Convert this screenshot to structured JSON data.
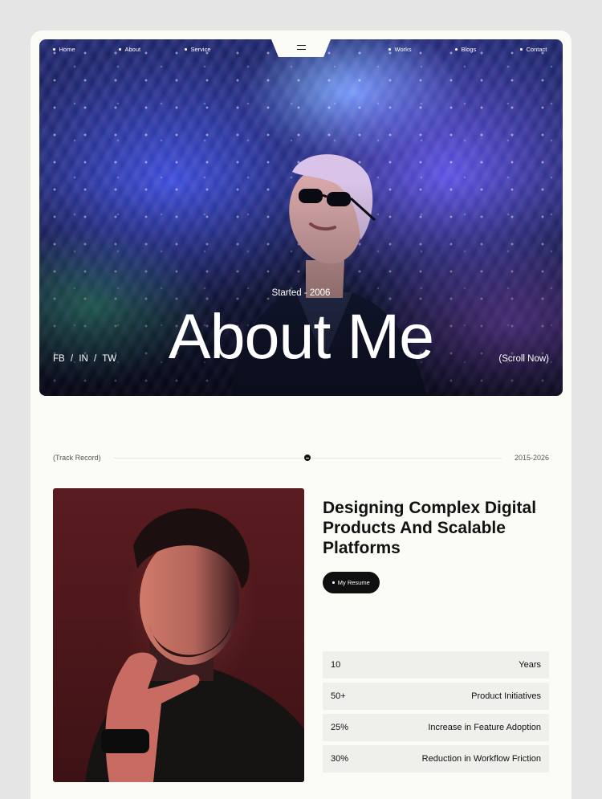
{
  "nav": {
    "left": [
      "Home",
      "About",
      "Service"
    ],
    "right": [
      "Works",
      "Blogs",
      "Contact"
    ]
  },
  "hero": {
    "eyebrow": "Started - 2006",
    "title": "About Me",
    "social": [
      "FB",
      "/",
      "IN",
      "/",
      "TW"
    ],
    "scroll_label": "(Scroll Now)"
  },
  "track": {
    "label": "(Track Record)",
    "years": "2015-2026"
  },
  "about": {
    "headline": "Designing Complex Digital Products And Scalable Platforms",
    "resume_label": "My Resume"
  },
  "stats": [
    {
      "value": "10",
      "label": "Years"
    },
    {
      "value": "50+",
      "label": "Product Initiatives"
    },
    {
      "value": "25%",
      "label": "Increase in Feature Adoption"
    },
    {
      "value": "30%",
      "label": "Reduction in Workflow Friction"
    }
  ],
  "colors": {
    "page_bg": "#e5e5e5",
    "card_bg": "#fbfcf6",
    "button_bg": "#0f0f0f",
    "stat_bg": "#eff0eb",
    "portrait_bg": "#4c171b"
  }
}
